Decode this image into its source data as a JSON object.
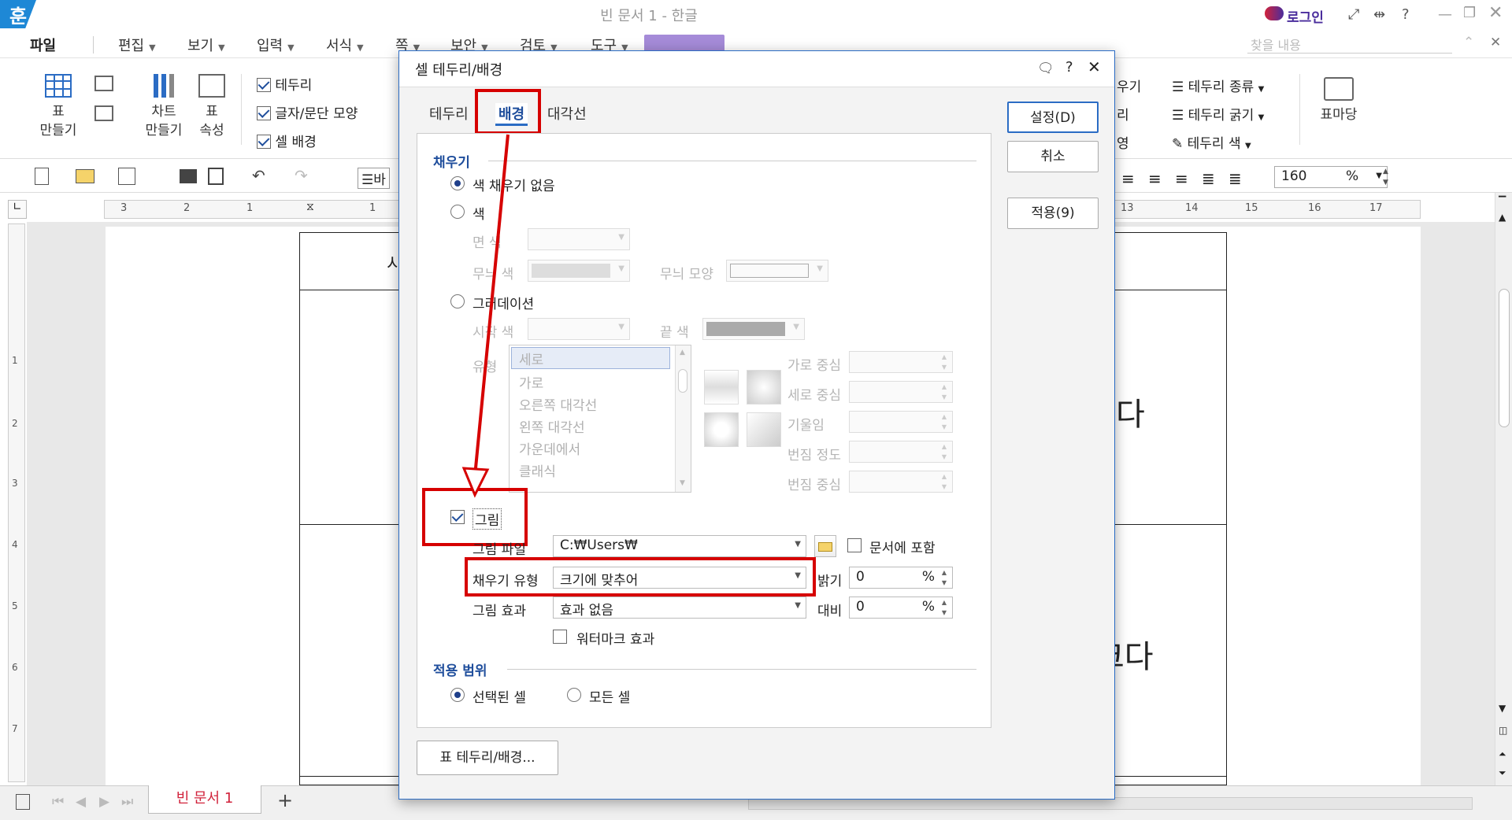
{
  "app": {
    "window_title": "빈 문서 1 - 한글",
    "logo_letter": "훈",
    "login_label": "로그인",
    "search_placeholder": "찾을 내용",
    "help_icon": "?"
  },
  "menubar": {
    "file": "파일",
    "items": [
      "편집",
      "보기",
      "입력",
      "서식",
      "쪽",
      "보안",
      "검토",
      "도구"
    ]
  },
  "ribbon": {
    "table_make": "표\n만들기",
    "chart_make": "차트\n만들기",
    "table_props": "표\n속성",
    "border_check": "테두리",
    "charpara_check": "글자/문단 모양",
    "cellbg_check": "셀 배경",
    "right_group": [
      "테두리 종류",
      "테두리 굵기",
      "테두리 색"
    ],
    "right_left_partial": [
      "우기",
      "리",
      "영"
    ],
    "table_garden": "표마당",
    "zoom_value": "160",
    "zoom_unit": "%"
  },
  "toolbar2": {
    "style_partial": "바"
  },
  "ruler_ticks": [
    "3",
    "2",
    "1",
    "1",
    "13",
    "14",
    "15",
    "16",
    "17"
  ],
  "vruler_ticks": [
    "1",
    "2",
    "3",
    "4",
    "5",
    "6",
    "7"
  ],
  "document": {
    "cell_fragment_1": "시",
    "cell_fragment_2": "다",
    "cell_fragment_3": "크다"
  },
  "status": {
    "doc_tab": "빈 문서 1",
    "add_tab": "+"
  },
  "dialog": {
    "title": "셀 테두리/배경",
    "tabs": [
      "테두리",
      "배경",
      "대각선"
    ],
    "active_tab": "배경",
    "buttons": {
      "ok": "설정(D)",
      "cancel": "취소",
      "apply": "적용(9)",
      "table_border": "표 테두리/배경..."
    },
    "fill": {
      "section": "채우기",
      "no_fill": "색 채우기 없음",
      "color": "색",
      "face_color": "면 색",
      "pattern_color": "무늬 색",
      "pattern_shape": "무늬 모양",
      "gradation": "그러데이션",
      "start_color": "시작 색",
      "end_color": "끝 색",
      "type": "유형",
      "gradient_types": [
        "세로",
        "가로",
        "오른쪽 대각선",
        "왼쪽 대각선",
        "가운데에서",
        "클래식"
      ],
      "h_center": "가로 중심",
      "v_center": "세로 중심",
      "tilt": "기울임",
      "blur_degree": "번짐 정도",
      "blur_center": "번짐 중심",
      "picture": "그림",
      "picture_checked": true,
      "picture_file": "그림 파일",
      "picture_path": "C:₩Users₩",
      "include_in_doc": "문서에 포함",
      "fill_type_label": "채우기 유형",
      "fill_type_value": "크기에 맞추어",
      "brightness": "밝기",
      "brightness_value": "0",
      "picture_effect": "그림 효과",
      "picture_effect_value": "효과 없음",
      "contrast": "대비",
      "contrast_value": "0",
      "percent": "%",
      "watermark": "워터마크 효과"
    },
    "scope": {
      "section": "적용 범위",
      "selected": "선택된 셀",
      "all": "모든 셀"
    }
  },
  "colors": {
    "accent": "#2b6cc4",
    "highlight_red": "#d60000",
    "tab_red": "#d1223b"
  }
}
